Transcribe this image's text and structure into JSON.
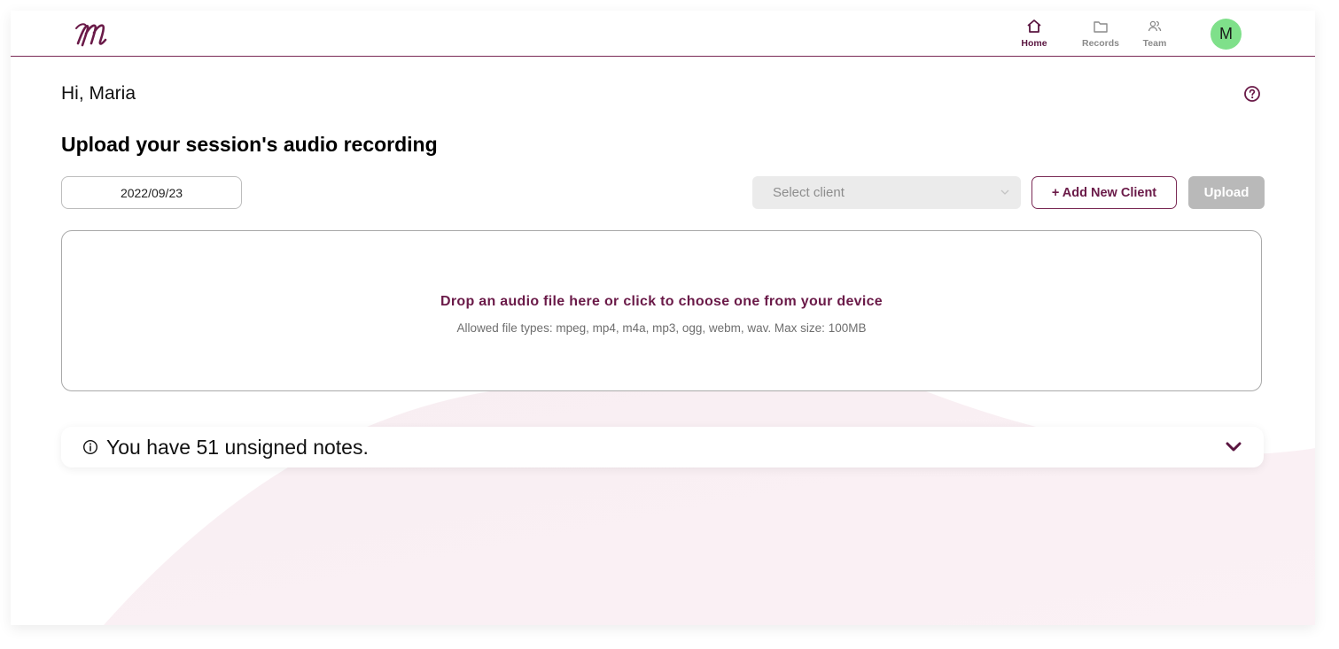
{
  "nav": {
    "items": [
      {
        "label": "Home",
        "icon": "home-icon",
        "active": true
      },
      {
        "label": "Records",
        "icon": "folder-icon",
        "active": false
      },
      {
        "label": "Team",
        "icon": "users-icon",
        "active": false
      }
    ],
    "avatar_initial": "M"
  },
  "page": {
    "greeting": "Hi, Maria",
    "heading": "Upload your session's audio recording"
  },
  "upload": {
    "date_value": "2022/09/23",
    "client_placeholder": "Select client",
    "add_client_label": "+ Add New Client",
    "upload_label": "Upload"
  },
  "dropzone": {
    "title": "Drop an audio file here or click to choose one from your device",
    "subtitle": "Allowed file types: mpeg, mp4, m4a, mp3, ogg, webm, wav. Max size: 100MB"
  },
  "notes": {
    "text": "You have 51 unsigned notes."
  },
  "colors": {
    "brand": "#6a1a48",
    "avatar": "#7fe08a",
    "disabled_button": "#b9b9b9"
  }
}
